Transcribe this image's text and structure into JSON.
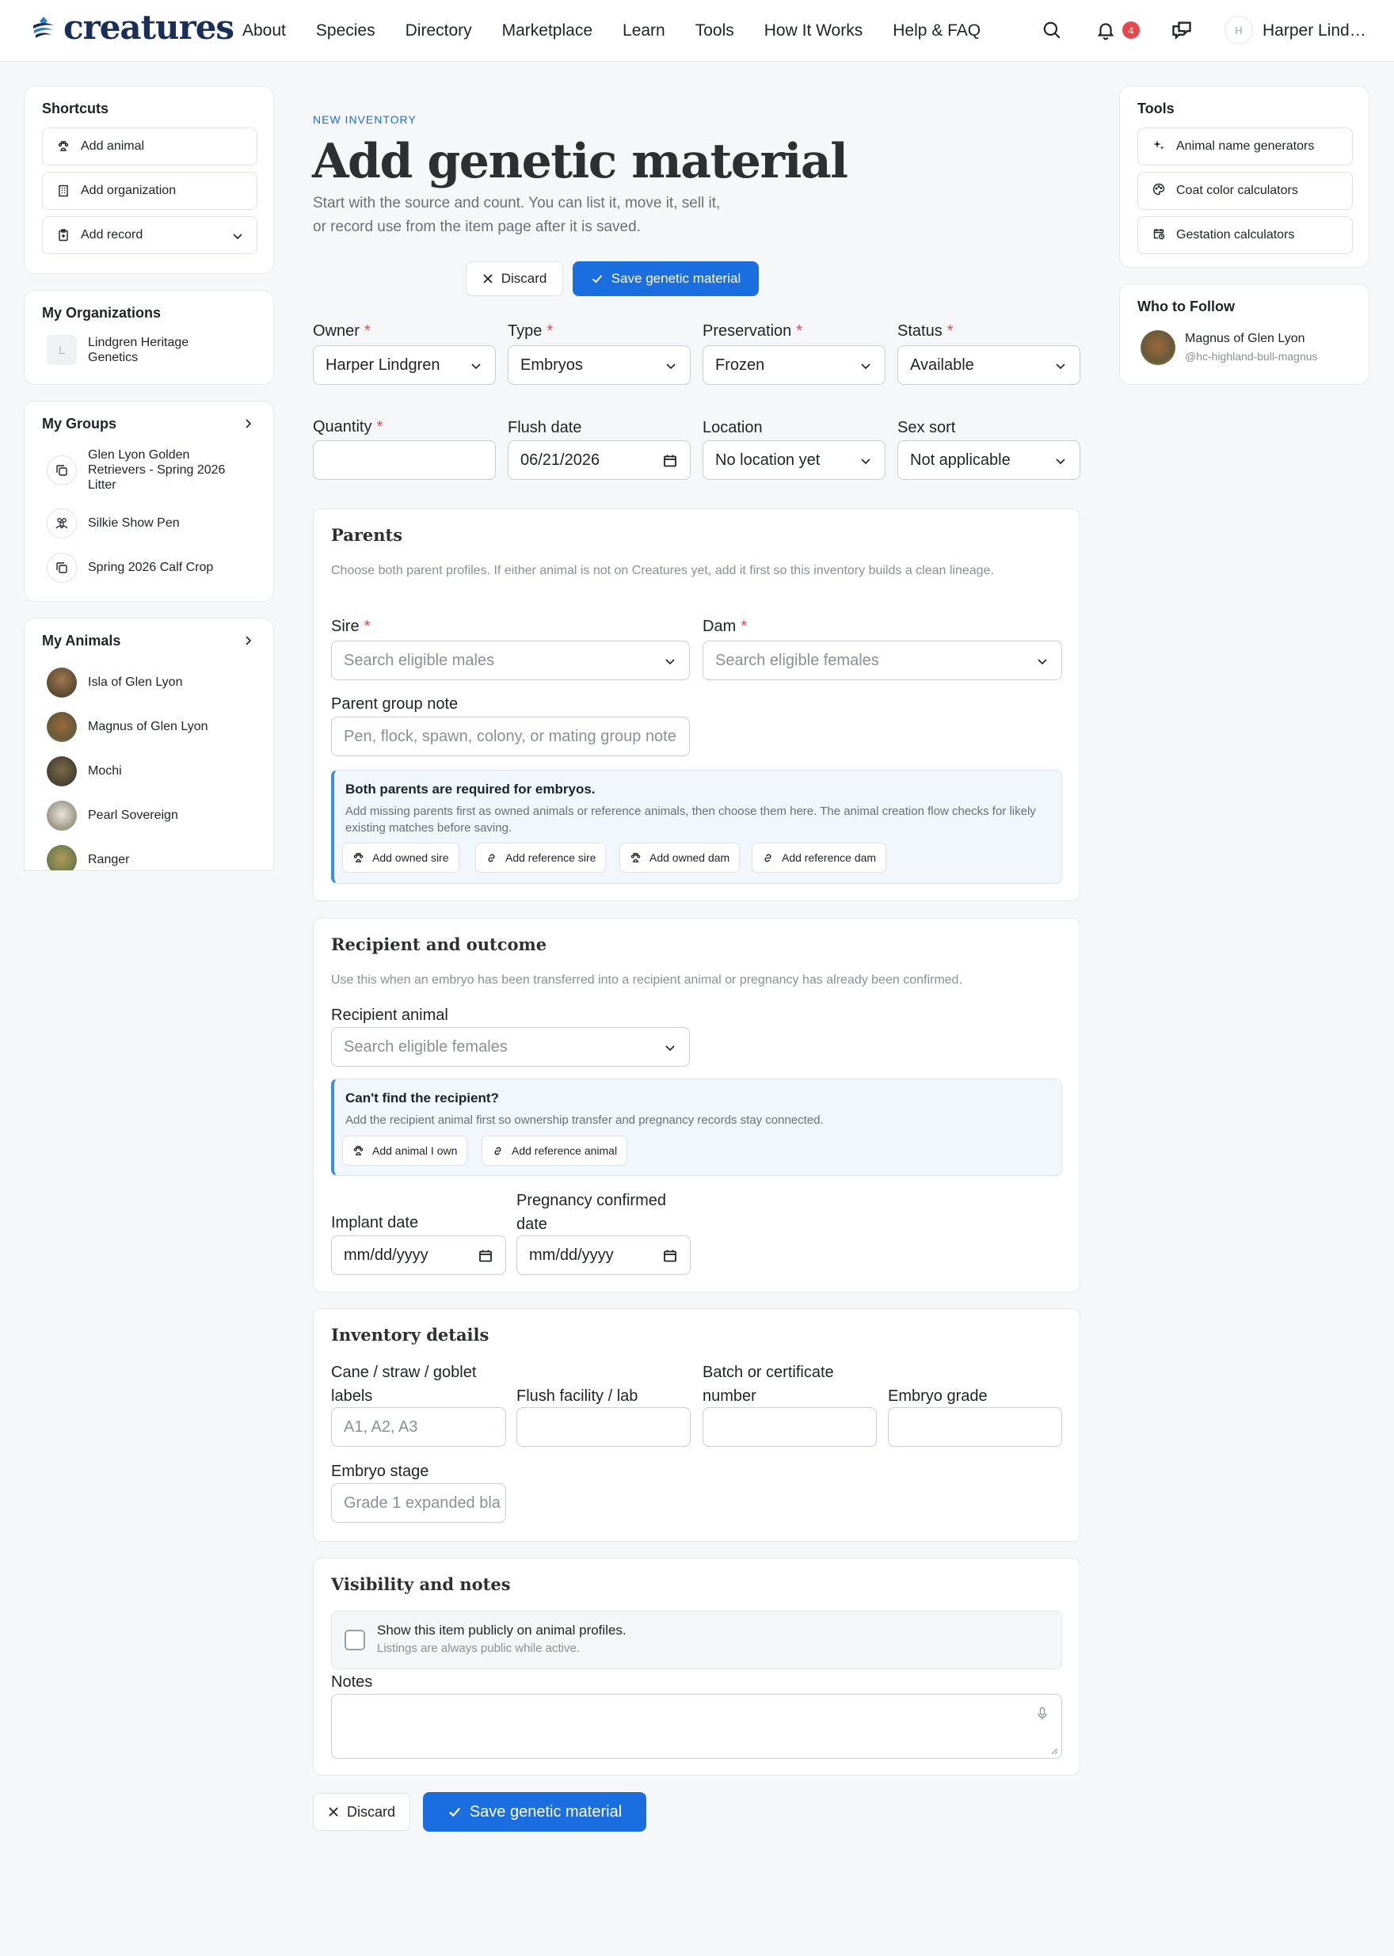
{
  "header": {
    "logo_text": "creatures",
    "nav": [
      "About",
      "Species",
      "Directory",
      "Marketplace",
      "Learn",
      "Tools",
      "How It Works",
      "Help & FAQ"
    ],
    "notification_count": "4",
    "avatar_initial": "H",
    "user_name": "Harper Lind…"
  },
  "left": {
    "shortcuts": {
      "title": "Shortcuts",
      "items": [
        {
          "label": "Add animal",
          "icon": "paw-icon"
        },
        {
          "label": "Add organization",
          "icon": "building-icon"
        },
        {
          "label": "Add record",
          "icon": "clipboard-icon"
        }
      ]
    },
    "orgs": {
      "title": "My Organizations",
      "items": [
        {
          "initial": "L",
          "name": "Lindgren Heritage Genetics"
        }
      ]
    },
    "groups": {
      "title": "My Groups",
      "items": [
        {
          "name": "Glen Lyon Golden Retrievers - Spring 2026 Litter",
          "icon": "copy-icon"
        },
        {
          "name": "Silkie Show Pen",
          "icon": "group-icon"
        },
        {
          "name": "Spring 2026 Calf Crop",
          "icon": "copy-icon"
        }
      ]
    },
    "animals": {
      "title": "My Animals",
      "items": [
        {
          "name": "Isla of Glen Lyon",
          "color": "#7b5a3c"
        },
        {
          "name": "Magnus of Glen Lyon",
          "color": "#8a5a2c"
        },
        {
          "name": "Mochi",
          "color": "#6b5a3a"
        },
        {
          "name": "Pearl Sovereign",
          "color": "#c9c3b6"
        },
        {
          "name": "Ranger",
          "color": "#8a7a4a"
        }
      ]
    }
  },
  "main": {
    "eyebrow": "NEW INVENTORY",
    "title": "Add genetic material",
    "subtitle": "Start with the source and count. You can list it, move it, sell it, or record use from the item page after it is saved.",
    "discard_label": "Discard",
    "save_label": "Save genetic material",
    "fields": {
      "owner": {
        "label": "Owner",
        "value": "Harper Lindgren"
      },
      "type": {
        "label": "Type",
        "value": "Embryos"
      },
      "preservation": {
        "label": "Preservation",
        "value": "Frozen"
      },
      "status": {
        "label": "Status",
        "value": "Available"
      },
      "quantity": {
        "label": "Quantity",
        "value": ""
      },
      "flush_date": {
        "label": "Flush date",
        "value": "06/21/2026"
      },
      "location": {
        "label": "Location",
        "value": "No location yet"
      },
      "sex_sort": {
        "label": "Sex sort",
        "value": "Not applicable"
      }
    },
    "parents": {
      "title": "Parents",
      "desc": "Choose both parent profiles. If either animal is not on Creatures yet, add it first so this inventory builds a clean lineage.",
      "sire_label": "Sire",
      "sire_placeholder": "Search eligible males",
      "dam_label": "Dam",
      "dam_placeholder": "Search eligible females",
      "note_label": "Parent group note",
      "note_placeholder": "Pen, flock, spawn, colony, or mating group note",
      "callout_title": "Both parents are required for embryos.",
      "callout_desc": "Add missing parents first as owned animals or reference animals, then choose them here. The animal creation flow checks for likely existing matches before saving.",
      "buttons": [
        "Add owned sire",
        "Add reference sire",
        "Add owned dam",
        "Add reference dam"
      ]
    },
    "recipient": {
      "title": "Recipient and outcome",
      "desc": "Use this when an embryo has been transferred into a recipient animal or pregnancy has already been confirmed.",
      "animal_label": "Recipient animal",
      "animal_placeholder": "Search eligible females",
      "callout_title": "Can't find the recipient?",
      "callout_desc": "Add the recipient animal first so ownership transfer and pregnancy records stay connected.",
      "buttons": [
        "Add animal I own",
        "Add reference animal"
      ],
      "implant_label": "Implant date",
      "implant_value": "mm/dd/yyyy",
      "pregnancy_label": "Pregnancy confirmed date",
      "pregnancy_value": "mm/dd/yyyy"
    },
    "inventory": {
      "title": "Inventory details",
      "cane_label": "Cane / straw / goblet labels",
      "cane_placeholder": "A1, A2, A3",
      "facility_label": "Flush facility / lab",
      "batch_label": "Batch or certificate number",
      "grade_label": "Embryo grade",
      "stage_label": "Embryo stage",
      "stage_placeholder": "Grade 1 expanded bla"
    },
    "visibility": {
      "title": "Visibility and notes",
      "checkbox_label": "Show this item publicly on animal profiles.",
      "checkbox_hint": "Listings are always public while active.",
      "notes_label": "Notes"
    }
  },
  "right": {
    "tools": {
      "title": "Tools",
      "items": [
        {
          "label": "Animal name generators",
          "icon": "sparkle-icon"
        },
        {
          "label": "Coat color calculators",
          "icon": "palette-icon"
        },
        {
          "label": "Gestation calculators",
          "icon": "calendar-clock-icon"
        }
      ]
    },
    "follow": {
      "title": "Who to Follow",
      "name": "Magnus of Glen Lyon",
      "handle": "@hc-highland-bull-magnus"
    }
  }
}
